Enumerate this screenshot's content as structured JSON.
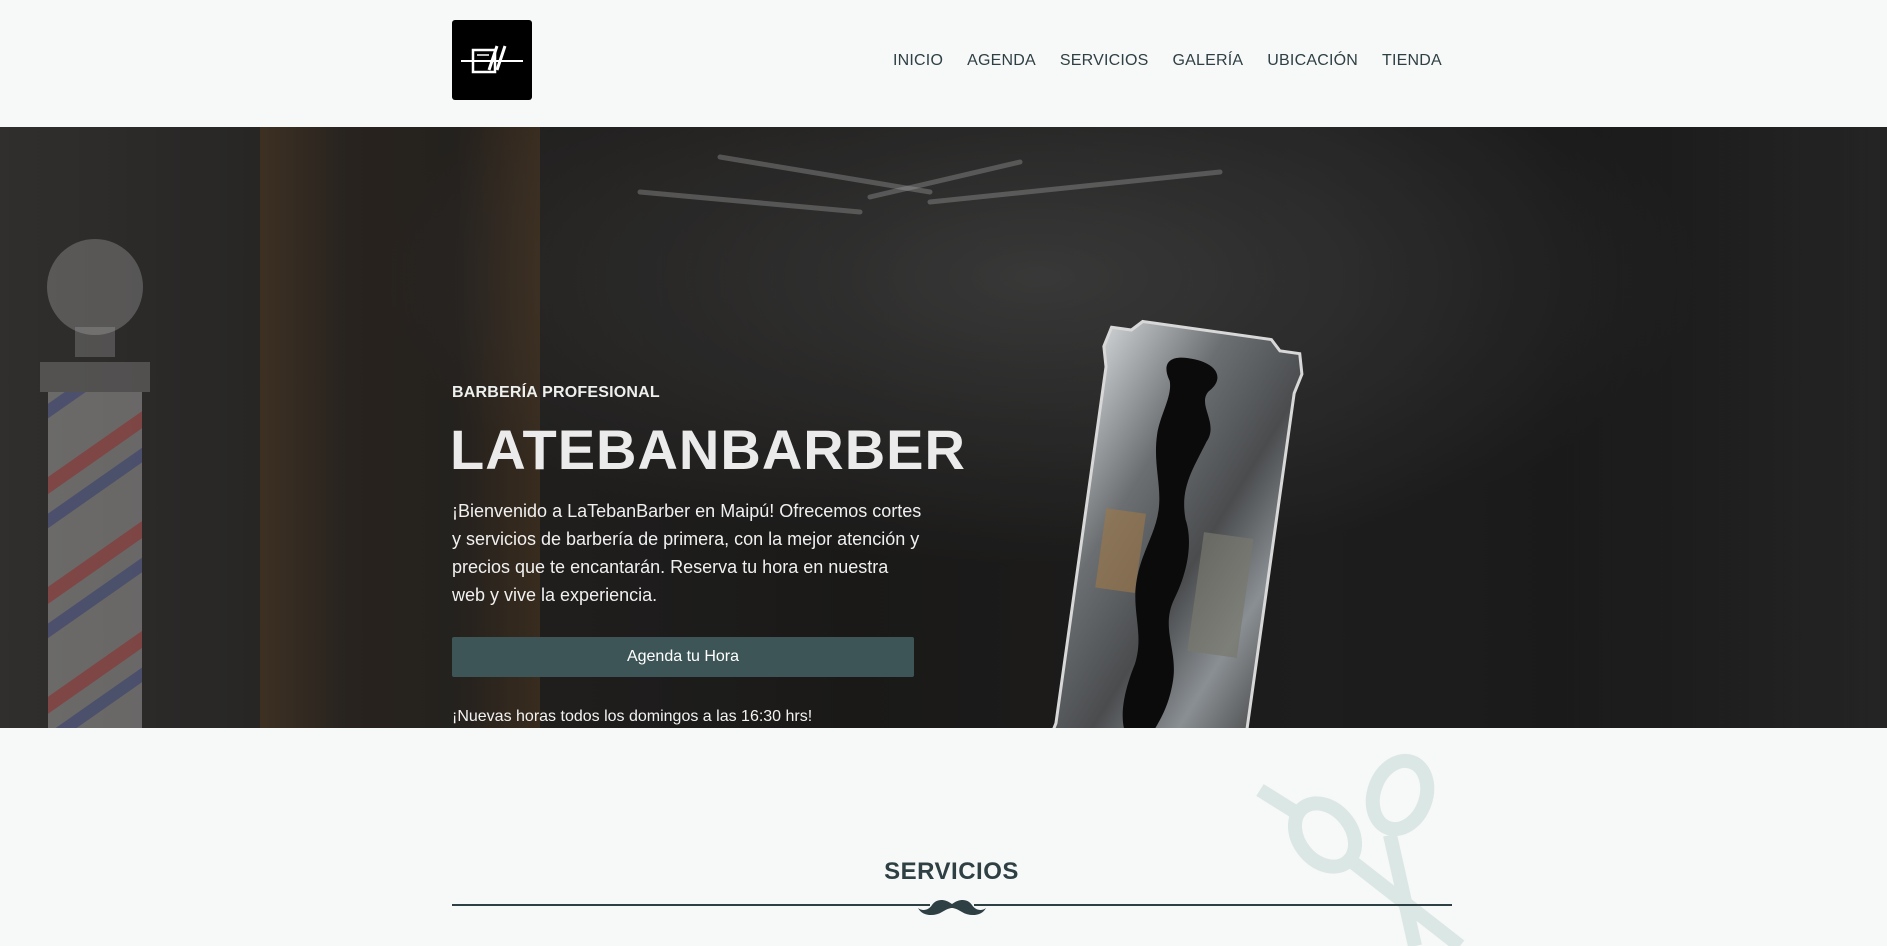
{
  "header": {
    "logo_alt": "LaTebanBarber logo",
    "nav": [
      {
        "label": "INICIO"
      },
      {
        "label": "AGENDA"
      },
      {
        "label": "SERVICIOS"
      },
      {
        "label": "GALERÍA"
      },
      {
        "label": "UBICACIÓN"
      },
      {
        "label": "TIENDA"
      }
    ]
  },
  "hero": {
    "eyebrow": "BARBERÍA PROFESIONAL",
    "title": "LATEBANBARBER",
    "intro": "¡Bienvenido a LaTebanBarber en Maipú! Ofrecemos cortes y servicios de barbería de primera, con la mejor atención y precios que te encantarán. Reserva tu hora en nuestra web y vive la experiencia.",
    "cta_label": "Agenda tu Hora",
    "notice": "¡Nuevas horas todos los domingos a las 16:30 hrs!"
  },
  "services": {
    "title": "SERVICIOS",
    "divider_icon": "mustache-icon",
    "background_icon": "scissors-icon"
  },
  "colors": {
    "text_dark": "#2f4044",
    "button_bg": "#3d5557",
    "page_bg": "#f7f8f8",
    "scissors_tint": "#dbe7e4"
  }
}
